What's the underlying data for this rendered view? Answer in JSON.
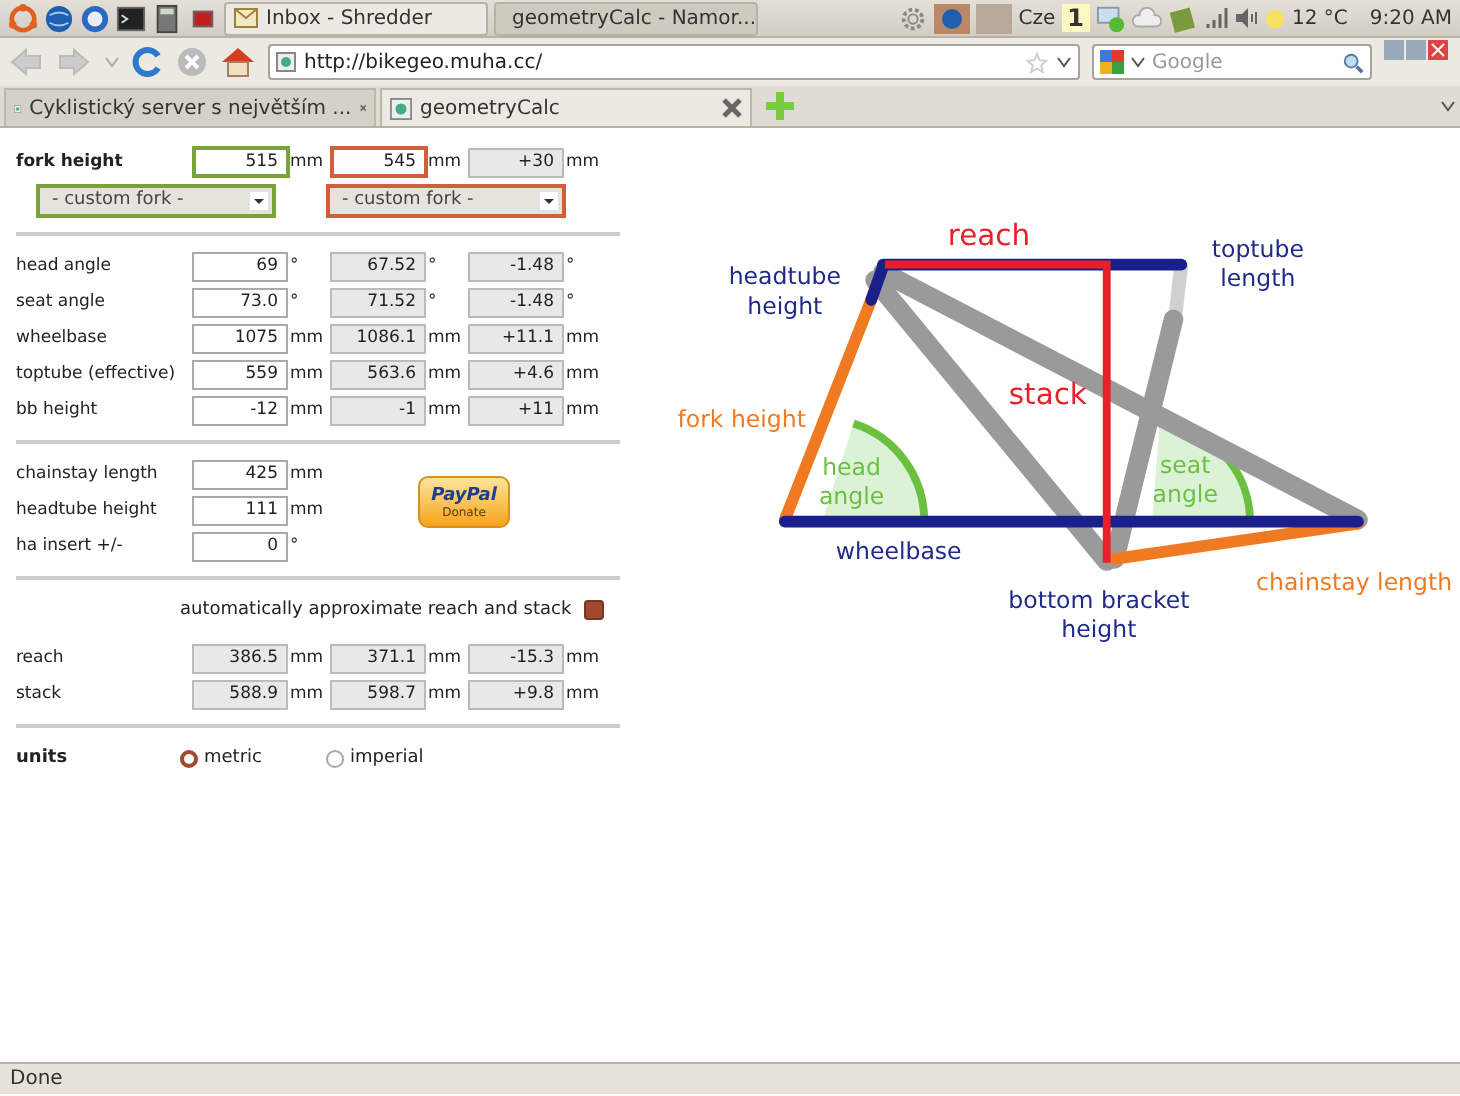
{
  "panel": {
    "taskbar": [
      {
        "title": "Inbox - Shredder",
        "selected": false
      },
      {
        "title": "geometryCalc - Namor...",
        "selected": true
      }
    ],
    "keyboard": "Cze",
    "workspace": "1",
    "temperature": "12 °C",
    "time": "9:20 AM"
  },
  "navbar": {
    "url": "http://bikegeo.muha.cc/",
    "search_placeholder": "Google"
  },
  "tabs": [
    {
      "label": "Cyklistický server s největším ...",
      "selected": false
    },
    {
      "label": "geometryCalc",
      "selected": true
    }
  ],
  "form": {
    "fork": {
      "label": "fork height",
      "values": [
        {
          "value": "515",
          "unit": "mm",
          "editable": true,
          "color": "#7aa23a"
        },
        {
          "value": "545",
          "unit": "mm",
          "editable": true,
          "color": "#d0603a"
        },
        {
          "value": "+30",
          "unit": "mm",
          "editable": false
        }
      ]
    },
    "fork_selects": [
      {
        "value": "- custom fork -",
        "color": "#7aa23a"
      },
      {
        "value": "- custom fork -",
        "color": "#d0603a"
      }
    ],
    "angles": [
      {
        "label": "head angle",
        "values": [
          {
            "value": "69",
            "unit": "°",
            "editable": true
          },
          {
            "value": "67.52",
            "unit": "°",
            "editable": false
          },
          {
            "value": "-1.48",
            "unit": "°",
            "editable": false
          }
        ]
      },
      {
        "label": "seat angle",
        "values": [
          {
            "value": "73.0",
            "unit": "°",
            "editable": true
          },
          {
            "value": "71.52",
            "unit": "°",
            "editable": false
          },
          {
            "value": "-1.48",
            "unit": "°",
            "editable": false
          }
        ]
      },
      {
        "label": "wheelbase",
        "values": [
          {
            "value": "1075",
            "unit": "mm",
            "editable": true
          },
          {
            "value": "1086.1",
            "unit": "mm",
            "editable": false
          },
          {
            "value": "+11.1",
            "unit": "mm",
            "editable": false
          }
        ]
      },
      {
        "label": "toptube (effective)",
        "values": [
          {
            "value": "559",
            "unit": "mm",
            "editable": true
          },
          {
            "value": "563.6",
            "unit": "mm",
            "editable": false
          },
          {
            "value": "+4.6",
            "unit": "mm",
            "editable": false
          }
        ]
      },
      {
        "label": "bb height",
        "values": [
          {
            "value": "-12",
            "unit": "mm",
            "editable": true
          },
          {
            "value": "-1",
            "unit": "mm",
            "editable": false
          },
          {
            "value": "+11",
            "unit": "mm",
            "editable": false
          }
        ]
      }
    ],
    "extras": [
      {
        "label": "chainstay length",
        "values": [
          {
            "value": "425",
            "unit": "mm",
            "editable": true
          }
        ]
      },
      {
        "label": "headtube height",
        "values": [
          {
            "value": "111",
            "unit": "mm",
            "editable": true
          }
        ]
      },
      {
        "label": "ha insert +/-",
        "values": [
          {
            "value": "0",
            "unit": "°",
            "editable": true
          }
        ]
      }
    ],
    "paypal": {
      "brand": "PayPal",
      "label": "Donate"
    },
    "auto": {
      "label": "automatically approximate reach and stack",
      "checked": true
    },
    "results": [
      {
        "label": "reach",
        "values": [
          {
            "value": "386.5",
            "unit": "mm",
            "editable": false
          },
          {
            "value": "371.1",
            "unit": "mm",
            "editable": false
          },
          {
            "value": "-15.3",
            "unit": "mm",
            "editable": false
          }
        ]
      },
      {
        "label": "stack",
        "values": [
          {
            "value": "588.9",
            "unit": "mm",
            "editable": false
          },
          {
            "value": "598.7",
            "unit": "mm",
            "editable": false
          },
          {
            "value": "+9.8",
            "unit": "mm",
            "editable": false
          }
        ]
      }
    ],
    "units": {
      "label": "units",
      "options": [
        {
          "label": "metric",
          "selected": true
        },
        {
          "label": "imperial",
          "selected": false
        }
      ]
    }
  },
  "diagram": {
    "labels": [
      {
        "lines": [
          "reach"
        ],
        "color": "#e8202a"
      },
      {
        "lines": [
          "headtube",
          "height"
        ],
        "color": "#1f2a8a"
      },
      {
        "lines": [
          "toptube",
          "length"
        ],
        "color": "#1f2a8a"
      },
      {
        "lines": [
          "stack"
        ],
        "color": "#e8202a"
      },
      {
        "lines": [
          "fork height"
        ],
        "color": "#f07a22"
      },
      {
        "lines": [
          "head",
          "angle"
        ],
        "color": "#6cc040"
      },
      {
        "lines": [
          "seat",
          "angle"
        ],
        "color": "#6cc040"
      },
      {
        "lines": [
          "wheelbase"
        ],
        "color": "#1f2a8a"
      },
      {
        "lines": [
          "bottom bracket",
          "height"
        ],
        "color": "#1f2a8a"
      },
      {
        "lines": [
          "chainstay length"
        ],
        "color": "#f07a22"
      }
    ]
  },
  "status": "Done"
}
